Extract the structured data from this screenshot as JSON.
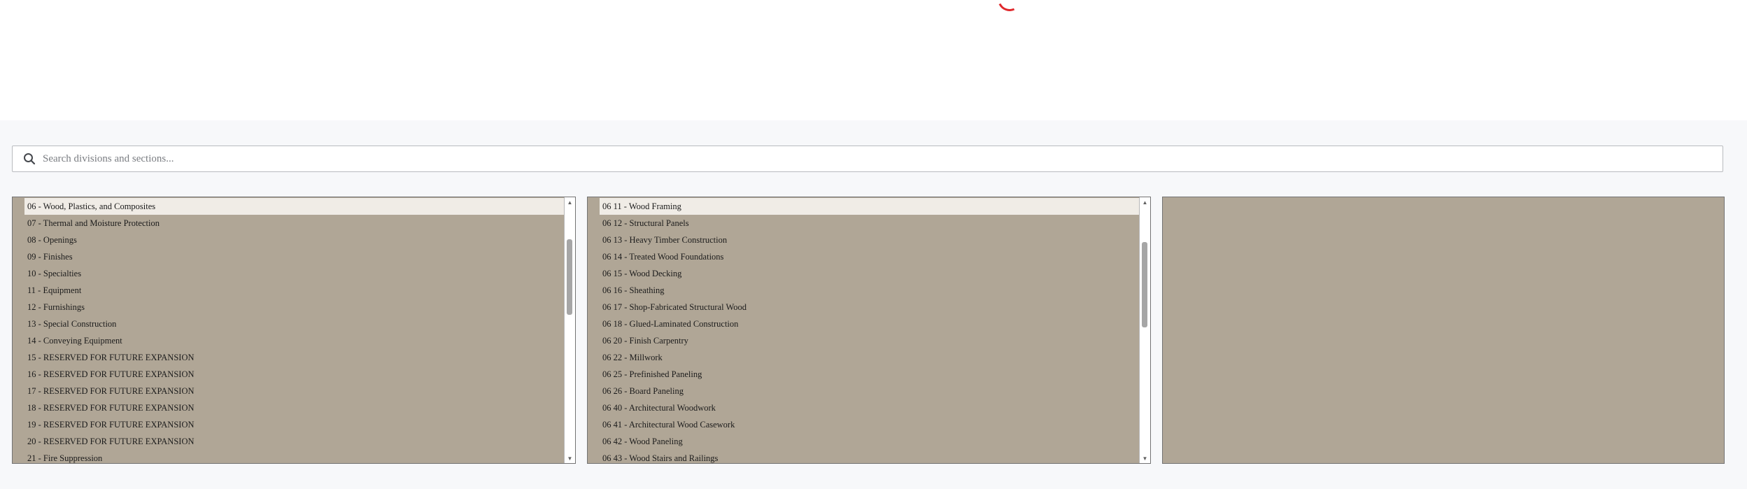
{
  "search": {
    "placeholder": "Search divisions and sections..."
  },
  "divisions": {
    "items": [
      "06 - Wood, Plastics, and Composites",
      "07 - Thermal and Moisture Protection",
      "08 - Openings",
      "09 - Finishes",
      "10 - Specialties",
      "11 - Equipment",
      "12 - Furnishings",
      "13 - Special Construction",
      "14 - Conveying Equipment",
      "15 - RESERVED FOR FUTURE EXPANSION",
      "16 - RESERVED FOR FUTURE EXPANSION",
      "17 - RESERVED FOR FUTURE EXPANSION",
      "18 - RESERVED FOR FUTURE EXPANSION",
      "19 - RESERVED FOR FUTURE EXPANSION",
      "20 - RESERVED FOR FUTURE EXPANSION",
      "21 - Fire Suppression"
    ],
    "selected": "06 - Wood, Plastics, and Composites"
  },
  "sections": {
    "items": [
      "06 11 - Wood Framing",
      "06 12 - Structural Panels",
      "06 13 - Heavy Timber Construction",
      "06 14 - Treated Wood Foundations",
      "06 15 - Wood Decking",
      "06 16 - Sheathing",
      "06 17 - Shop-Fabricated Structural Wood",
      "06 18 - Glued-Laminated Construction",
      "06 20 - Finish Carpentry",
      "06 22 - Millwork",
      "06 25 - Prefinished Paneling",
      "06 26 - Board Paneling",
      "06 40 - Architectural Woodwork",
      "06 41 - Architectural Wood Casework",
      "06 42 - Wood Paneling",
      "06 43 - Wood Stairs and Railings"
    ],
    "selected": "06 11 - Wood Framing"
  },
  "subsections": {
    "items": []
  },
  "icons": {
    "search": "search-icon",
    "spinner": "loading-spinner-icon",
    "scroll_up": "scroll-up-arrow-icon",
    "scroll_down": "scroll-down-arrow-icon"
  },
  "colors": {
    "panel_bg": "#b0a696",
    "selected_bg": "#f0ece6",
    "spinner": "#e0282c"
  }
}
